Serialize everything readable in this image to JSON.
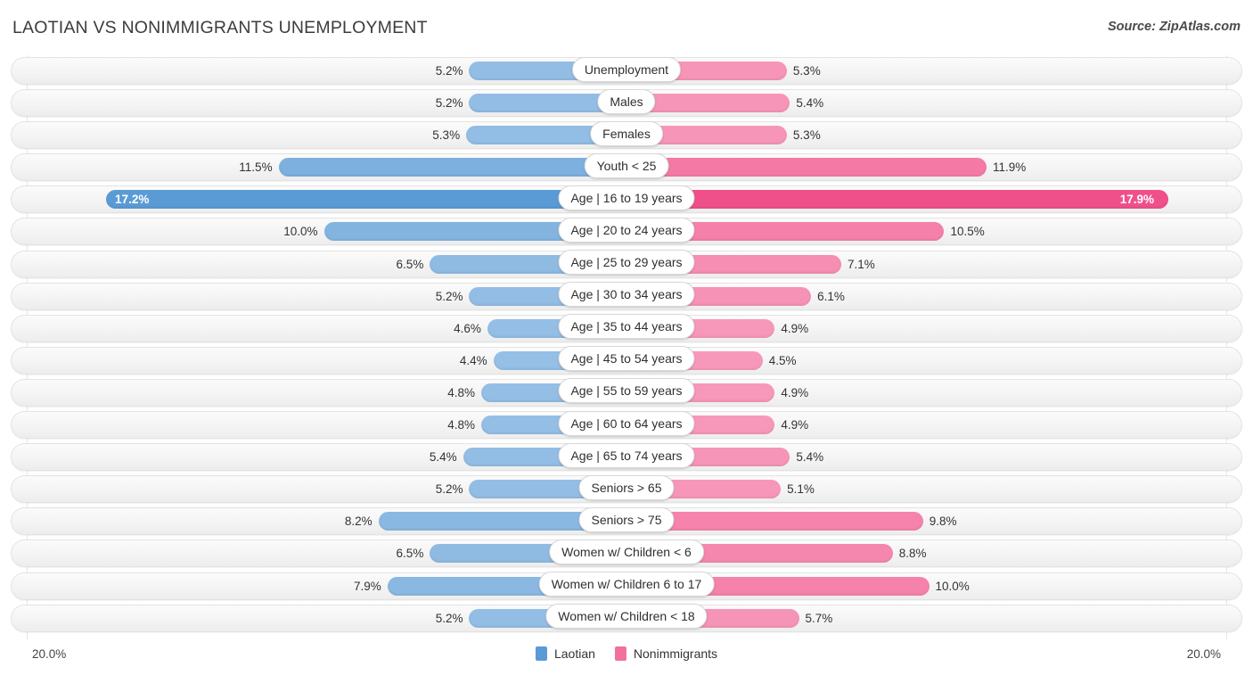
{
  "header": {
    "title": "LAOTIAN VS NONIMMIGRANTS UNEMPLOYMENT",
    "source": "Source: ZipAtlas.com"
  },
  "footer": {
    "axis_left": "20.0%",
    "axis_right": "20.0%",
    "legend": [
      {
        "label": "Laotian",
        "color": "#5B9BD5",
        "icon": "legend-swatch-laotian"
      },
      {
        "label": "Nonimmigrants",
        "color": "#F2709C",
        "icon": "legend-swatch-nonimmigrants"
      }
    ]
  },
  "colors": {
    "left_light": "#9FC5E8",
    "left_strong": "#5B9BD5",
    "right_light": "#F8A5C2",
    "right_strong": "#F0508A",
    "track": "#F4F4F4",
    "grid": "#E6E6E6"
  },
  "chart_data": {
    "type": "bar",
    "orientation": "horizontal-diverging",
    "title": "LAOTIAN VS NONIMMIGRANTS UNEMPLOYMENT",
    "xlabel": "",
    "ylabel": "",
    "axis_max_percent": 20.0,
    "xlim": [
      20.0,
      20.0
    ],
    "grid": true,
    "legend_position": "bottom-center",
    "unit": "%",
    "series": [
      {
        "name": "Laotian",
        "side": "left",
        "color": "#5B9BD5",
        "values": [
          5.2,
          5.2,
          5.3,
          11.5,
          17.2,
          10.0,
          6.5,
          5.2,
          4.6,
          4.4,
          4.8,
          4.8,
          5.4,
          5.2,
          8.2,
          6.5,
          7.9,
          5.2
        ]
      },
      {
        "name": "Nonimmigrants",
        "side": "right",
        "color": "#F2709C",
        "values": [
          5.3,
          5.4,
          5.3,
          11.9,
          17.9,
          10.5,
          7.1,
          6.1,
          4.9,
          4.5,
          4.9,
          4.9,
          5.4,
          5.1,
          9.8,
          8.8,
          10.0,
          5.7
        ]
      }
    ],
    "categories": [
      "Unemployment",
      "Males",
      "Females",
      "Youth < 25",
      "Age | 16 to 19 years",
      "Age | 20 to 24 years",
      "Age | 25 to 29 years",
      "Age | 30 to 34 years",
      "Age | 35 to 44 years",
      "Age | 45 to 54 years",
      "Age | 55 to 59 years",
      "Age | 60 to 64 years",
      "Age | 65 to 74 years",
      "Seniors > 65",
      "Seniors > 75",
      "Women w/ Children < 6",
      "Women w/ Children 6 to 17",
      "Women w/ Children < 18"
    ],
    "rows": [
      {
        "label": "Unemployment",
        "left": 5.2,
        "right": 5.3,
        "left_text": "5.2%",
        "right_text": "5.3%",
        "emphasis": false
      },
      {
        "label": "Males",
        "left": 5.2,
        "right": 5.4,
        "left_text": "5.2%",
        "right_text": "5.4%",
        "emphasis": false
      },
      {
        "label": "Females",
        "left": 5.3,
        "right": 5.3,
        "left_text": "5.3%",
        "right_text": "5.3%",
        "emphasis": false
      },
      {
        "label": "Youth < 25",
        "left": 11.5,
        "right": 11.9,
        "left_text": "11.5%",
        "right_text": "11.9%",
        "emphasis": false
      },
      {
        "label": "Age | 16 to 19 years",
        "left": 17.2,
        "right": 17.9,
        "left_text": "17.2%",
        "right_text": "17.9%",
        "emphasis": true
      },
      {
        "label": "Age | 20 to 24 years",
        "left": 10.0,
        "right": 10.5,
        "left_text": "10.0%",
        "right_text": "10.5%",
        "emphasis": false
      },
      {
        "label": "Age | 25 to 29 years",
        "left": 6.5,
        "right": 7.1,
        "left_text": "6.5%",
        "right_text": "7.1%",
        "emphasis": false
      },
      {
        "label": "Age | 30 to 34 years",
        "left": 5.2,
        "right": 6.1,
        "left_text": "5.2%",
        "right_text": "6.1%",
        "emphasis": false
      },
      {
        "label": "Age | 35 to 44 years",
        "left": 4.6,
        "right": 4.9,
        "left_text": "4.6%",
        "right_text": "4.9%",
        "emphasis": false
      },
      {
        "label": "Age | 45 to 54 years",
        "left": 4.4,
        "right": 4.5,
        "left_text": "4.4%",
        "right_text": "4.5%",
        "emphasis": false
      },
      {
        "label": "Age | 55 to 59 years",
        "left": 4.8,
        "right": 4.9,
        "left_text": "4.8%",
        "right_text": "4.9%",
        "emphasis": false
      },
      {
        "label": "Age | 60 to 64 years",
        "left": 4.8,
        "right": 4.9,
        "left_text": "4.8%",
        "right_text": "4.9%",
        "emphasis": false
      },
      {
        "label": "Age | 65 to 74 years",
        "left": 5.4,
        "right": 5.4,
        "left_text": "5.4%",
        "right_text": "5.4%",
        "emphasis": false
      },
      {
        "label": "Seniors > 65",
        "left": 5.2,
        "right": 5.1,
        "left_text": "5.2%",
        "right_text": "5.1%",
        "emphasis": false
      },
      {
        "label": "Seniors > 75",
        "left": 8.2,
        "right": 9.8,
        "left_text": "8.2%",
        "right_text": "9.8%",
        "emphasis": false
      },
      {
        "label": "Women w/ Children < 6",
        "left": 6.5,
        "right": 8.8,
        "left_text": "6.5%",
        "right_text": "8.8%",
        "emphasis": false
      },
      {
        "label": "Women w/ Children 6 to 17",
        "left": 7.9,
        "right": 10.0,
        "left_text": "7.9%",
        "right_text": "10.0%",
        "emphasis": false
      },
      {
        "label": "Women w/ Children < 18",
        "left": 5.2,
        "right": 5.7,
        "left_text": "5.2%",
        "right_text": "5.7%",
        "emphasis": false
      }
    ]
  }
}
